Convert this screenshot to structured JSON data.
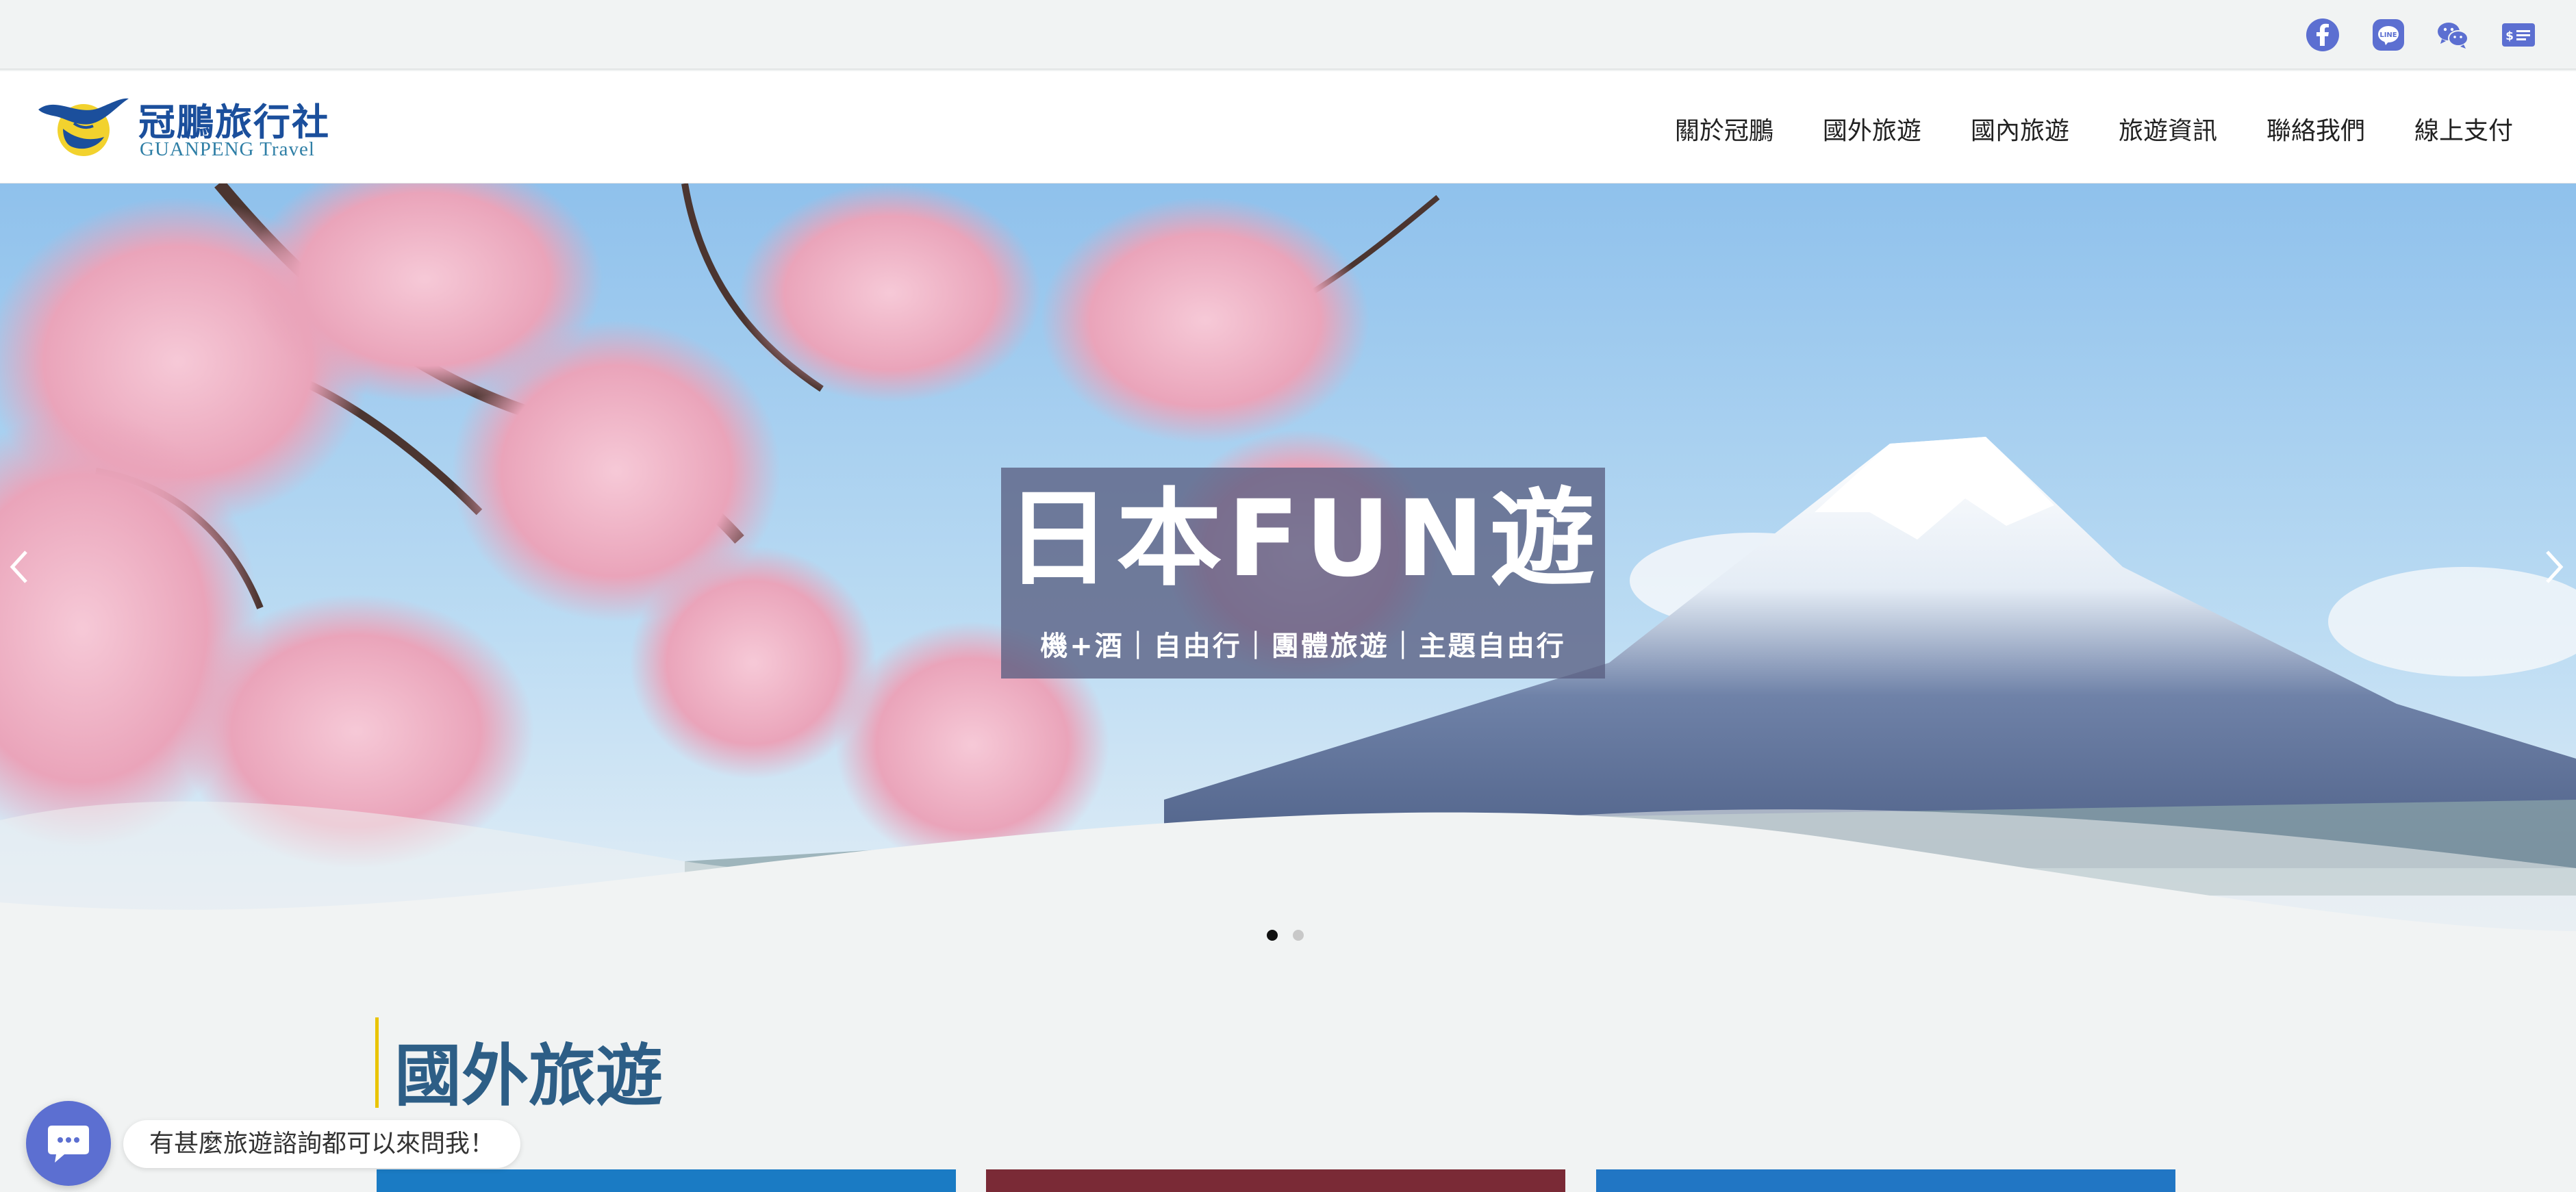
{
  "topbar": {
    "social": [
      {
        "name": "facebook-icon",
        "color": "#5c6fd1"
      },
      {
        "name": "line-icon",
        "color": "#5c6fd1"
      },
      {
        "name": "wechat-icon",
        "color": "#5c6fd1"
      },
      {
        "name": "payment-icon",
        "color": "#5c6fd1"
      }
    ]
  },
  "header": {
    "logo_cn": "冠鵬旅行社",
    "logo_en": "GUANPENG Travel",
    "nav": [
      "關於冠鵬",
      "國外旅遊",
      "國內旅遊",
      "旅遊資訊",
      "聯絡我們",
      "線上支付"
    ]
  },
  "hero": {
    "banner_title": "日本FUN遊",
    "banner_subtitle": "機+酒｜自由行｜團體旅遊｜主題自由行",
    "slides_total": 2,
    "active_slide": 1
  },
  "section": {
    "title": "國外旅遊"
  },
  "chat": {
    "bubble_text": "有甚麼旅遊諮詢都可以來問我！"
  },
  "colors": {
    "accent": "#5c6fd1",
    "section_title": "#2d5e86",
    "section_bar": "#e9c400"
  }
}
